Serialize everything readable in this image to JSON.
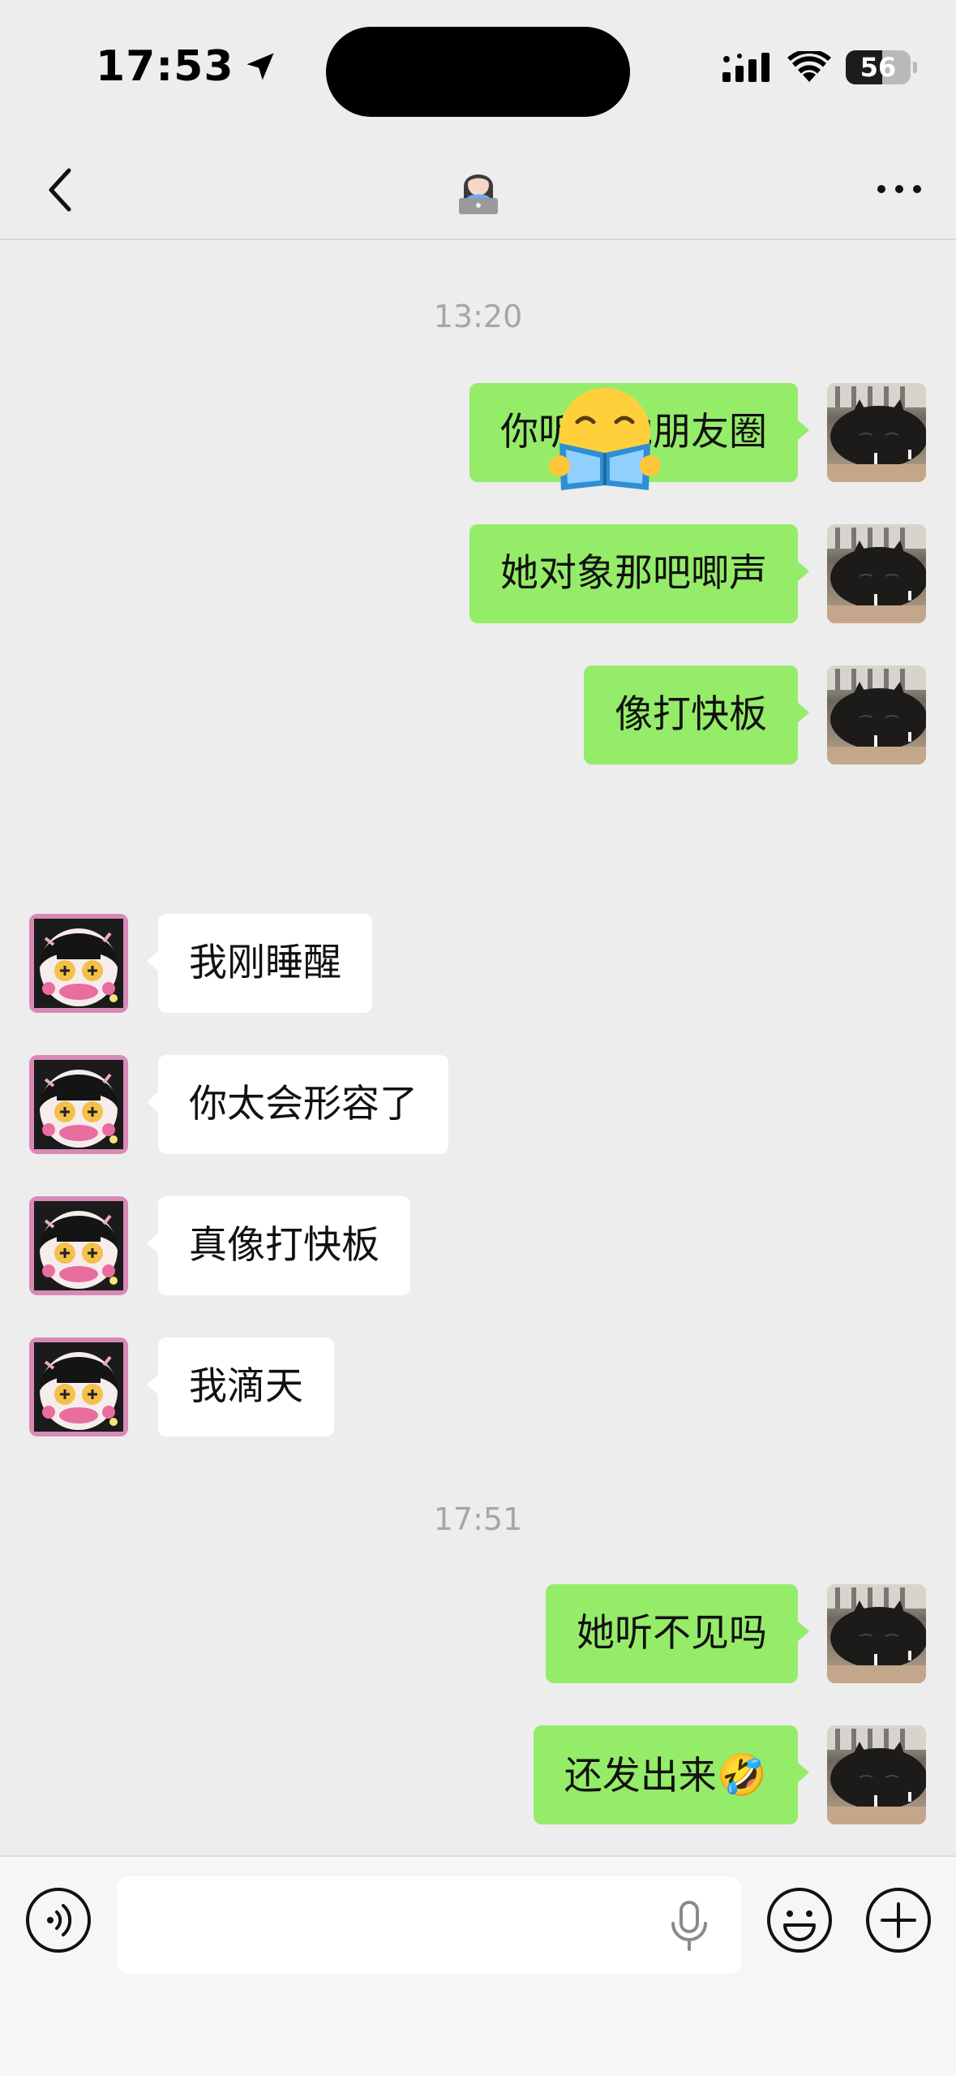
{
  "status_bar": {
    "time": "17:53",
    "battery_level": "56",
    "battery_fraction": 0.56
  },
  "header": {
    "title_emoji": "👩🏻‍💻",
    "back_icon": "chevron-left-icon",
    "more_icon": "ellipsis-icon"
  },
  "chat": {
    "timestamps": [
      "13:20",
      "17:51"
    ],
    "messages": [
      {
        "side": "out",
        "text": "你听了她朋友圈"
      },
      {
        "side": "out",
        "text": "她对象那吧唧声"
      },
      {
        "side": "out",
        "text": "像打快板"
      },
      {
        "side": "in",
        "text": "我刚睡醒"
      },
      {
        "side": "in",
        "text": "你太会形容了"
      },
      {
        "side": "in",
        "text": "真像打快板"
      },
      {
        "side": "in",
        "text": "我滴天"
      },
      {
        "side": "out",
        "text": "她听不见吗"
      },
      {
        "side": "out",
        "text": "还发出来",
        "emoji": "🤣"
      }
    ],
    "sticker": "reading-emoji-sticker"
  },
  "input_bar": {
    "placeholder": "",
    "value": "",
    "icons": [
      "voice-icon",
      "mic-icon",
      "emoji-icon",
      "plus-icon"
    ]
  },
  "colors": {
    "background": "#ededed",
    "outgoing_bubble": "#95ec69",
    "incoming_bubble": "#ffffff",
    "timestamp": "#a6a6a6"
  }
}
